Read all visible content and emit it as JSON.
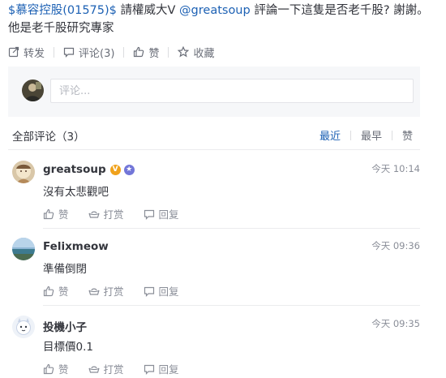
{
  "post": {
    "mention_stock": "$慕容控股(01575)$",
    "text_a": " 請權威大V ",
    "mention_user": "@greatsoup",
    "text_b": " 評論一下這隻是否老千股? 謝謝。他是老千股研究專家"
  },
  "actions": {
    "repost": "转发",
    "comment": "评论(3)",
    "like": "赞",
    "favorite": "收藏"
  },
  "comment_input": {
    "placeholder": "评论..."
  },
  "comments_header": {
    "title": "全部评论（3）",
    "sort_latest": "最近",
    "sort_oldest": "最早",
    "sort_likes": "赞"
  },
  "comments": [
    {
      "user": "greatsoup",
      "time": "今天 10:14",
      "text": "沒有太悲觀吧",
      "like": "赞",
      "tip": "打赏",
      "reply": "回复"
    },
    {
      "user": "Felixmeow",
      "time": "今天 09:36",
      "text": "準備倒閉",
      "like": "赞",
      "tip": "打赏",
      "reply": "回复"
    },
    {
      "user": "投機小子",
      "time": "今天 09:35",
      "text": "目標價0.1",
      "like": "赞",
      "tip": "打赏",
      "reply": "回复"
    }
  ],
  "colors": {
    "link": "#1d61b4",
    "verified_badge": "#f0a21c",
    "star_badge": "#7276d8"
  }
}
